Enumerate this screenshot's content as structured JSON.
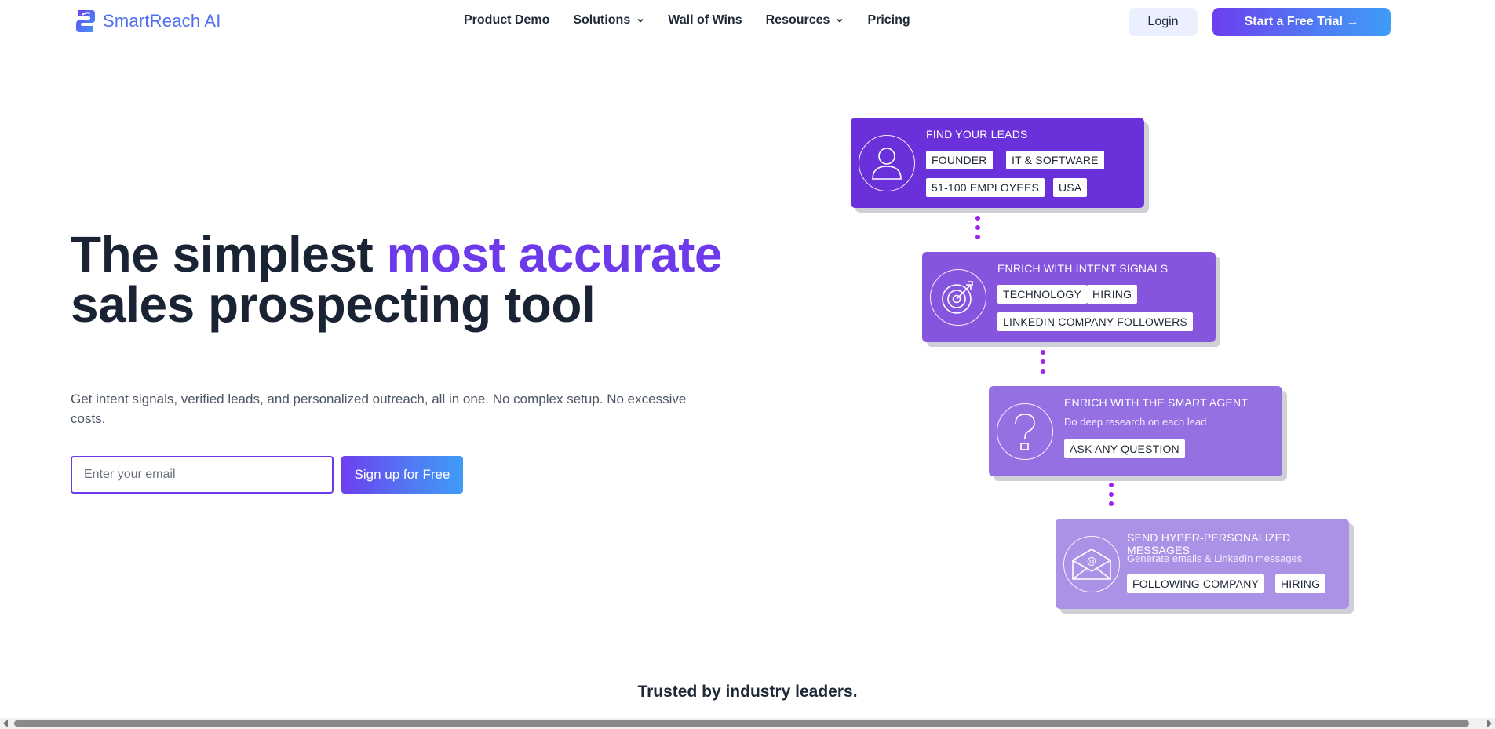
{
  "brand": {
    "name": "SmartReach AI",
    "color": "#4f6ef2"
  },
  "nav": {
    "links": [
      {
        "label": "Product Demo",
        "dropdown": false
      },
      {
        "label": "Solutions",
        "dropdown": true
      },
      {
        "label": "Wall of Wins",
        "dropdown": false
      },
      {
        "label": "Resources",
        "dropdown": true
      },
      {
        "label": "Pricing",
        "dropdown": false
      }
    ],
    "login_label": "Login",
    "trial_label": "Start a Free Trial →"
  },
  "hero": {
    "title_part1": "The simplest ",
    "title_accent": "most accurate",
    "title_part2": "sales prospecting tool",
    "subtitle": "Get intent signals, verified leads, and personalized outreach, all in one. No complex setup. No excessive costs.",
    "email_placeholder": "Enter your email",
    "signup_label": "Sign up for Free",
    "accent_color": "#6c3aea"
  },
  "flow": {
    "cards": [
      {
        "title": "FIND YOUR LEADS",
        "subtitle": "",
        "icon": "person-icon",
        "tags": [
          "FOUNDER",
          "IT & SOFTWARE",
          "51-100 EMPLOYEES",
          "USA"
        ]
      },
      {
        "title": "ENRICH WITH INTENT SIGNALS",
        "subtitle": "",
        "icon": "target-icon",
        "tags": [
          "TECHNOLOGY",
          "HIRING",
          "LINKEDIN COMPANY FOLLOWERS"
        ]
      },
      {
        "title": "ENRICH WITH THE SMART AGENT",
        "subtitle": "Do deep research on each lead",
        "icon": "question-icon",
        "tags": [
          "ASK ANY QUESTION"
        ]
      },
      {
        "title": "SEND HYPER-PERSONALIZED MESSAGES",
        "subtitle": "Generate emails & LinkedIn messages",
        "icon": "envelope-icon",
        "tags": [
          "FOLLOWING COMPANY",
          "HIRING"
        ]
      }
    ],
    "card_colors": [
      "#6a30d9",
      "#8655dd",
      "#9570e2",
      "#ac92e7"
    ],
    "connector_color": "#a020f0"
  },
  "trusted": {
    "heading": "Trusted by industry leaders."
  }
}
